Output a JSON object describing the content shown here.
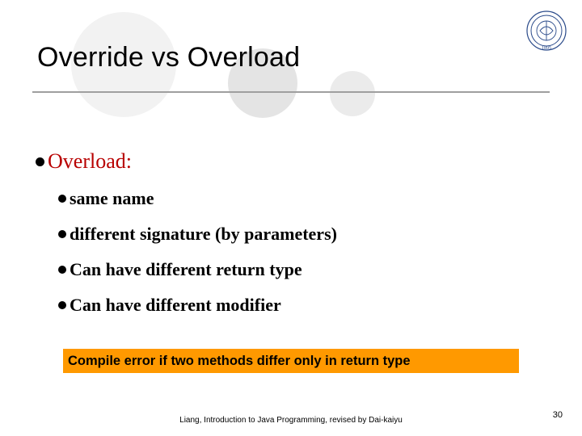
{
  "title": "Override vs Overload",
  "section": {
    "heading": "Overload:",
    "points": [
      "same name",
      "different signature (by parameters)",
      "Can have different return type",
      "Can have different modifier"
    ]
  },
  "note": "Compile error if two methods differ only in return type",
  "footer": "Liang, Introduction to Java Programming, revised by Dai-kaiyu",
  "page_number": "30",
  "logo_year": "1895"
}
